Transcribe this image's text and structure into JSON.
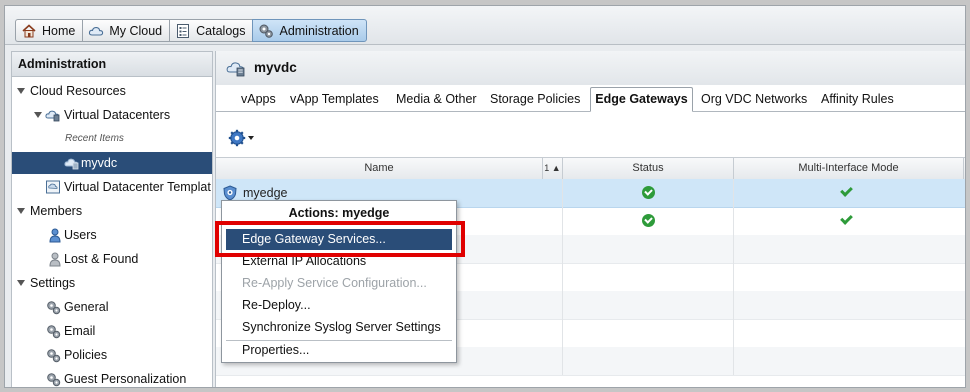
{
  "top_tabs": [
    {
      "label": "Home",
      "icon": "home-icon"
    },
    {
      "label": "My Cloud",
      "icon": "cloud-icon"
    },
    {
      "label": "Catalogs",
      "icon": "catalog-icon"
    },
    {
      "label": "Administration",
      "icon": "admin-gears-icon",
      "active": true
    }
  ],
  "sidebar": {
    "title": "Administration",
    "items": [
      {
        "label": "Cloud Resources"
      },
      {
        "label": "Virtual Datacenters"
      },
      {
        "label": "Recent Items"
      },
      {
        "label": "myvdc",
        "selected": true
      },
      {
        "label": "Virtual Datacenter Templat"
      },
      {
        "label": "Members"
      },
      {
        "label": "Users"
      },
      {
        "label": "Lost & Found"
      },
      {
        "label": "Settings"
      },
      {
        "label": "General"
      },
      {
        "label": "Email"
      },
      {
        "label": "Policies"
      },
      {
        "label": "Guest Personalization"
      }
    ]
  },
  "main": {
    "title": "myvdc",
    "tabs": [
      "vApps",
      "vApp Templates",
      "Media & Other",
      "Storage Policies",
      "Edge Gateways",
      "Org VDC Networks",
      "Affinity Rules"
    ],
    "active_tab": "Edge Gateways",
    "grid": {
      "columns": [
        "Name",
        "1 ▲",
        "Status",
        "Multi-Interface Mode"
      ],
      "rows": [
        {
          "name": "myedge",
          "status": "ok",
          "multi_interface": true,
          "selected": true
        },
        {
          "name": "",
          "status": "ok",
          "multi_interface": true
        }
      ]
    }
  },
  "context_menu": {
    "title": "Actions: myedge",
    "items": [
      {
        "label": "Edge Gateway Services...",
        "highlighted": true
      },
      {
        "label": "External IP Allocations"
      },
      {
        "label": "Re-Apply Service Configuration...",
        "disabled": true
      },
      {
        "label": "Re-Deploy..."
      },
      {
        "label": "Synchronize Syslog Server Settings"
      },
      {
        "label": "Properties..."
      }
    ]
  },
  "colors": {
    "selection": "#2a4d78",
    "row_selected": "#cfe6f8",
    "highlight_box": "#e00000",
    "ok_green": "#2e9b3a"
  }
}
